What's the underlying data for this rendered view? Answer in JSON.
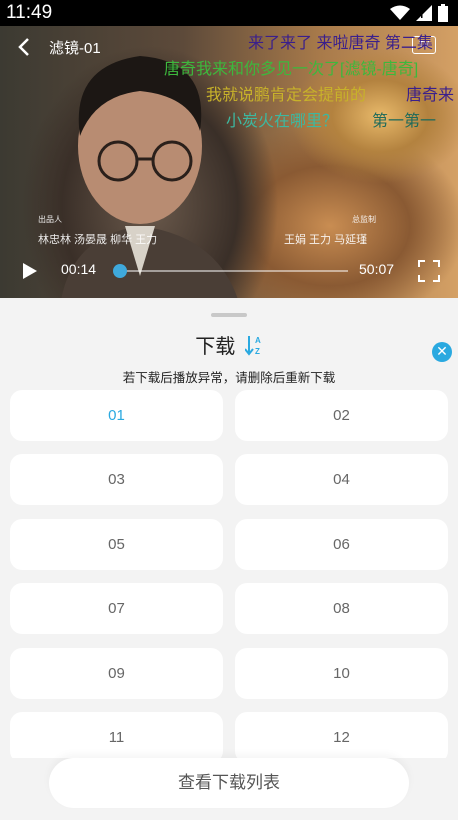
{
  "status_bar": {
    "time": "11:49"
  },
  "video": {
    "title": "滤镜-01",
    "tv_label": "TV",
    "current_time": "00:14",
    "duration": "50:07",
    "progress_fraction": 0.0047,
    "danmaku": [
      {
        "text": "来了来了  来啦唐奇  第二集",
        "color": "#3a1f8c"
      },
      {
        "text": "唐奇我来和你多见一次了[滤镜-唐奇]",
        "color": "#3db83d"
      },
      {
        "text": "我就说鹏肯定会提前的",
        "color": "#c8b22a"
      },
      {
        "text": "唐奇来",
        "color": "#3a1f8c"
      },
      {
        "text": "小炭火在哪里？",
        "color": "#3db8a0"
      },
      {
        "text": "第一第一",
        "color": "#1f6a5a"
      }
    ],
    "credits_left_small": "出品人",
    "credits_left": "林忠林  汤晏晟  柳华  王力",
    "credits_right_small": "总监制",
    "credits_right": "王娟  王力  马延瑾"
  },
  "sheet": {
    "title": "下载",
    "sort_icon_text": "A Z",
    "close_symbol": "✕",
    "hint": "若下载后播放异常，请删除后重新下载",
    "episodes": [
      "01",
      "02",
      "03",
      "04",
      "05",
      "06",
      "07",
      "08",
      "09",
      "10",
      "11",
      "12"
    ],
    "active_episode": "01",
    "view_list_label": "查看下载列表"
  },
  "colors": {
    "accent": "#2aa9e0"
  }
}
